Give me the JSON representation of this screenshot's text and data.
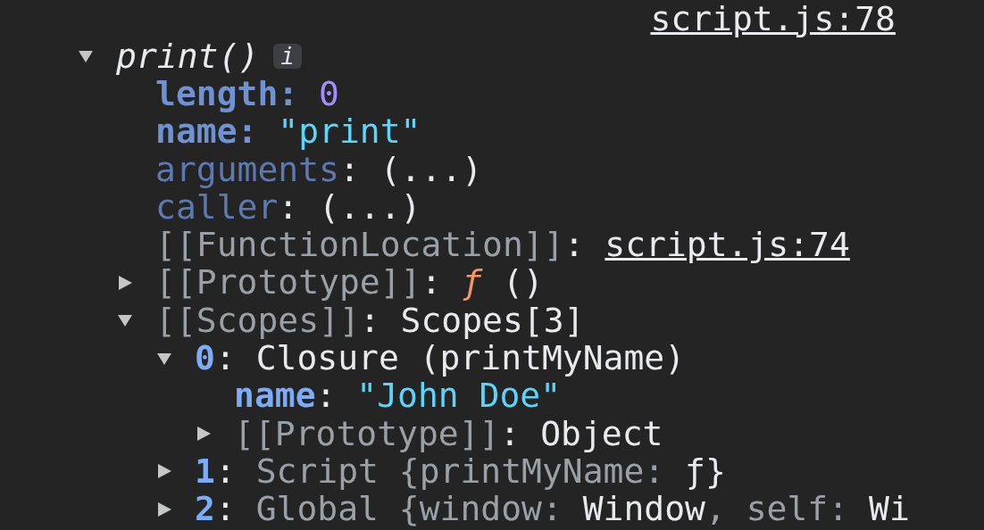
{
  "source_link": "script.js:78",
  "tree": [
    {
      "expanded": true,
      "segments": [
        {
          "kind": "fn",
          "text": "print()"
        }
      ],
      "badge": "i",
      "children": [
        {
          "segments": [
            {
              "kind": "key",
              "text": "length"
            },
            {
              "kind": "key",
              "text": ": "
            },
            {
              "kind": "number",
              "text": "0"
            }
          ]
        },
        {
          "segments": [
            {
              "kind": "key",
              "text": "name"
            },
            {
              "kind": "key",
              "text": ": "
            },
            {
              "kind": "string",
              "text": "\"print\""
            }
          ]
        },
        {
          "segments": [
            {
              "kind": "key-dim",
              "text": "arguments"
            },
            {
              "kind": "plain",
              "text": ": (...)"
            }
          ]
        },
        {
          "segments": [
            {
              "kind": "key-dim",
              "text": "caller"
            },
            {
              "kind": "plain",
              "text": ": (...)"
            }
          ]
        },
        {
          "segments": [
            {
              "kind": "internal",
              "text": "[[FunctionLocation]]"
            },
            {
              "kind": "plain",
              "text": ": "
            },
            {
              "kind": "link",
              "text": "script.js:74"
            }
          ]
        },
        {
          "expanded": false,
          "segments": [
            {
              "kind": "internal",
              "text": "[[Prototype]]"
            },
            {
              "kind": "plain",
              "text": ": "
            },
            {
              "kind": "fn-sign",
              "text": "ƒ"
            },
            {
              "kind": "plain",
              "text": " ()"
            }
          ]
        },
        {
          "expanded": true,
          "segments": [
            {
              "kind": "internal",
              "text": "[[Scopes]]"
            },
            {
              "kind": "plain",
              "text": ": Scopes[3]"
            }
          ],
          "children": [
            {
              "expanded": true,
              "segments": [
                {
                  "kind": "index",
                  "text": "0"
                },
                {
                  "kind": "plain",
                  "text": ": Closure (printMyName)"
                }
              ],
              "children": [
                {
                  "segments": [
                    {
                      "kind": "key-bright",
                      "text": "name"
                    },
                    {
                      "kind": "plain",
                      "text": ": "
                    },
                    {
                      "kind": "string",
                      "text": "\"John Doe\""
                    }
                  ]
                },
                {
                  "expanded": false,
                  "segments": [
                    {
                      "kind": "internal",
                      "text": "[[Prototype]]"
                    },
                    {
                      "kind": "plain",
                      "text": ": Object"
                    }
                  ]
                }
              ]
            },
            {
              "expanded": false,
              "segments": [
                {
                  "kind": "index",
                  "text": "1"
                },
                {
                  "kind": "plain",
                  "text": ": "
                },
                {
                  "kind": "muted",
                  "text": "Script {printMyName: "
                },
                {
                  "kind": "plain",
                  "text": "ƒ}"
                }
              ]
            },
            {
              "expanded": false,
              "segments": [
                {
                  "kind": "index",
                  "text": "2"
                },
                {
                  "kind": "plain",
                  "text": ": "
                },
                {
                  "kind": "muted",
                  "text": "Global {window: "
                },
                {
                  "kind": "plain",
                  "text": "Window"
                },
                {
                  "kind": "muted",
                  "text": ", self: "
                },
                {
                  "kind": "plain",
                  "text": "Wi"
                }
              ]
            }
          ]
        }
      ]
    }
  ]
}
